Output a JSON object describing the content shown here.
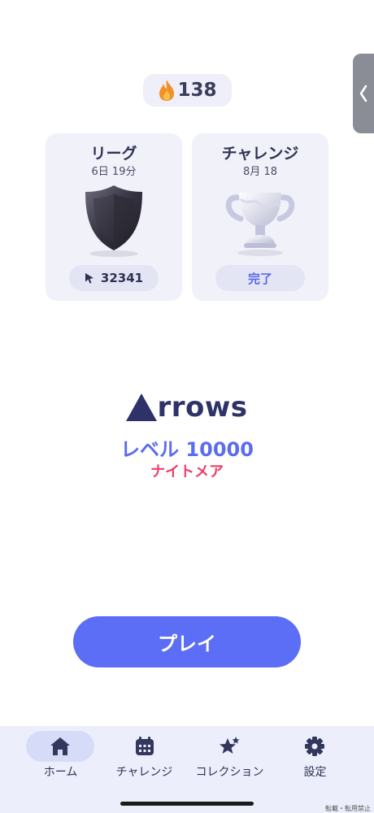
{
  "streak": {
    "icon": "flame-icon",
    "value": "138"
  },
  "cards": {
    "league": {
      "title": "リーグ",
      "subtitle": "6日 19分",
      "image": "shield-icon",
      "pill_icon": "cursor-icon",
      "pill_value": "32341"
    },
    "challenge": {
      "title": "チャレンジ",
      "subtitle": "8月 18",
      "image": "trophy-icon",
      "pill_value": "完了"
    }
  },
  "game": {
    "logo": "rrows",
    "level": "レベル 10000",
    "difficulty": "ナイトメア"
  },
  "play_label": "プレイ",
  "tabs": [
    {
      "label": "ホーム",
      "icon": "home-icon",
      "active": true
    },
    {
      "label": "チャレンジ",
      "icon": "calendar-icon",
      "active": false
    },
    {
      "label": "コレクション",
      "icon": "stars-icon",
      "active": false
    },
    {
      "label": "設定",
      "icon": "gear-icon",
      "active": false
    }
  ],
  "watermark": "転載・転用禁止",
  "colors": {
    "accent": "#5b6ef5",
    "difficulty": "#ee3f6a",
    "tab_bar": "#eceffb",
    "card": "#f0f1f9"
  }
}
